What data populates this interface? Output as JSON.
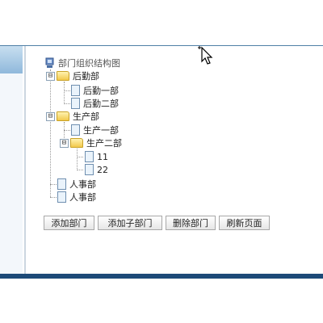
{
  "tree": {
    "root": {
      "label": "部门组织结构图"
    },
    "nodes": [
      {
        "label": "后勤部",
        "children": [
          "后勤一部",
          "后勤二部"
        ]
      },
      {
        "label": "生产部",
        "children": [
          "生产一部",
          {
            "label": "生产二部",
            "children": [
              "11",
              "22"
            ]
          }
        ]
      },
      {
        "label": "人事部"
      },
      {
        "label": "人事部"
      }
    ],
    "flat": {
      "n1": "后勤部",
      "n1a": "后勤一部",
      "n1b": "后勤二部",
      "n2": "生产部",
      "n2a": "生产一部",
      "n2b": "生产二部",
      "n2b1": "11",
      "n2b2": "22",
      "n3": "人事部",
      "n4": "人事部"
    },
    "toggle_expanded": "⊟"
  },
  "buttons": {
    "add_dept": "添加部门",
    "add_sub_dept": "添加子部门",
    "delete_dept": "删除部门",
    "refresh_page": "刷新页面"
  },
  "icons": {
    "root": "org-chart-icon",
    "folder": "folder-icon",
    "leaf": "document-icon",
    "cursor": "mouse-pointer-icon"
  },
  "colors": {
    "frame_bottom": "#1d4a78",
    "top_line": "#4f7fa6",
    "folder": "#f2c94c"
  }
}
